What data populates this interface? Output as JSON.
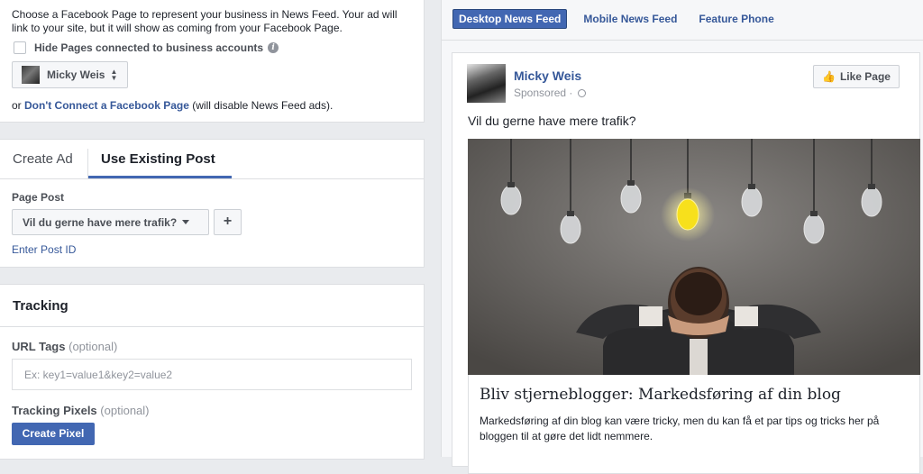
{
  "page_section": {
    "description": "Choose a Facebook Page to represent your business in News Feed. Your ad will link to your site, but it will show as coming from your Facebook Page.",
    "hide_pages_label": "Hide Pages connected to business accounts",
    "selected_page": "Micky Weis",
    "disconnect_prefix": "or",
    "disconnect_link": "Don't Connect a Facebook Page",
    "disconnect_suffix": "(will disable News Feed ads)."
  },
  "ad_tabs": [
    {
      "label": "Create Ad",
      "active": false
    },
    {
      "label": "Use Existing Post",
      "active": true
    }
  ],
  "page_post": {
    "label": "Page Post",
    "selected": "Vil du gerne have mere trafik?",
    "add_label": "+",
    "enter_post_id": "Enter Post ID"
  },
  "tracking": {
    "title": "Tracking",
    "url_tags_label": "URL Tags",
    "url_tags_optional": "(optional)",
    "url_tags_placeholder": "Ex: key1=value1&key2=value2",
    "pixels_label": "Tracking Pixels",
    "pixels_optional": "(optional)",
    "create_pixel": "Create Pixel"
  },
  "preview_tabs": [
    {
      "label": "Desktop News Feed",
      "active": true
    },
    {
      "label": "Mobile News Feed",
      "active": false
    },
    {
      "label": "Feature Phone",
      "active": false
    }
  ],
  "preview_post": {
    "page_name": "Micky Weis",
    "sponsored": "Sponsored ·",
    "like_button": "Like Page",
    "text": "Vil du gerne have mere trafik?",
    "link_title": "Bliv stjerneblogger: Markedsføring af din blog",
    "link_description": "Markedsføring af din blog kan være tricky, men du kan få et par tips og tricks her på bloggen til at gøre det lidt nemmere."
  },
  "colors": {
    "accent": "#4267b2",
    "link": "#365899",
    "bulb_lit": "#f7e01c"
  }
}
